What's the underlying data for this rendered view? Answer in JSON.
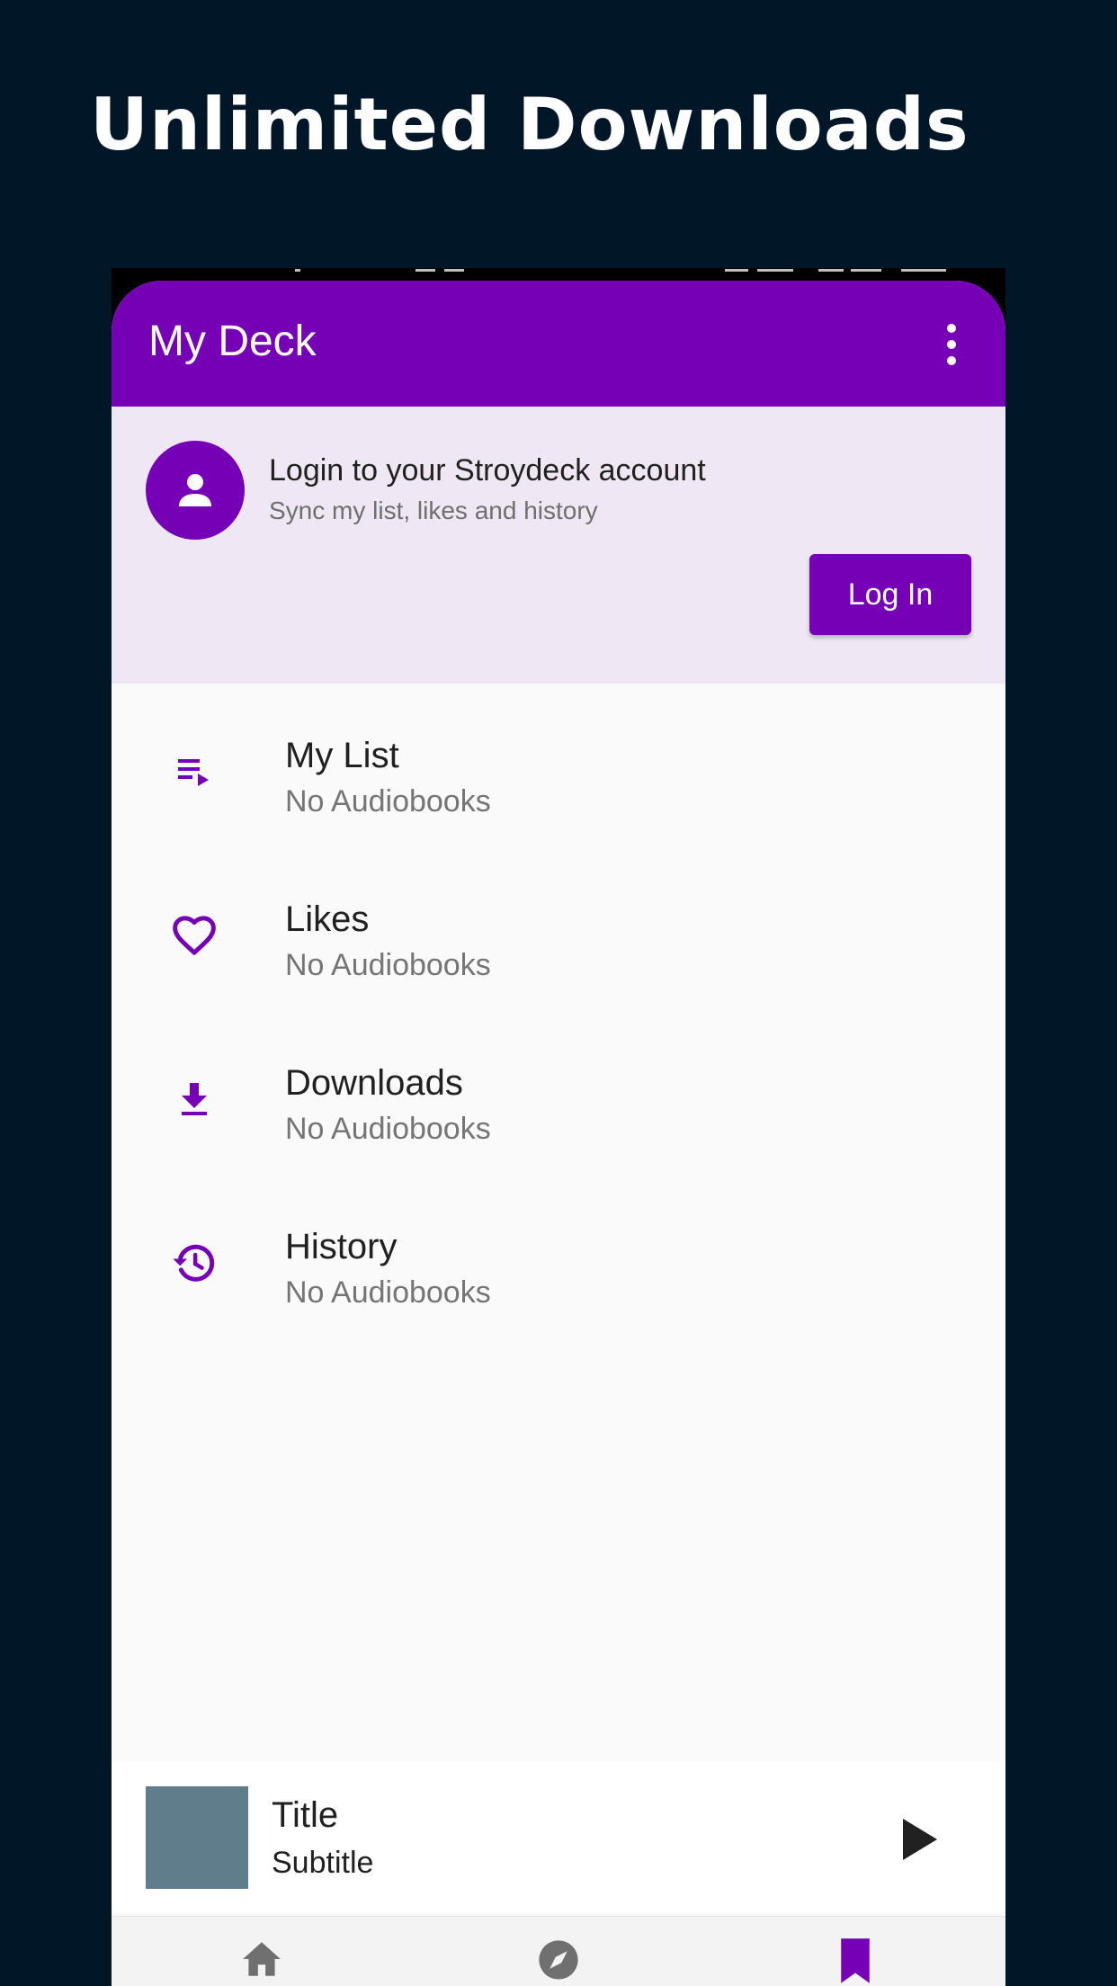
{
  "promo": {
    "headline": "Unlimited Downloads"
  },
  "appbar": {
    "title": "My Deck",
    "menu_icon": "more-vert-icon"
  },
  "login_card": {
    "avatar_icon": "person-icon",
    "title": "Login to your Stroydeck account",
    "subtitle": "Sync my list, likes and history",
    "button_label": "Log In"
  },
  "menu": {
    "items": [
      {
        "icon": "playlist-play-icon",
        "label": "My List",
        "sub": "No Audiobooks"
      },
      {
        "icon": "heart-outline-icon",
        "label": "Likes",
        "sub": "No Audiobooks"
      },
      {
        "icon": "download-icon",
        "label": "Downloads",
        "sub": "No Audiobooks"
      },
      {
        "icon": "history-icon",
        "label": "History",
        "sub": "No Audiobooks"
      }
    ]
  },
  "player": {
    "title": "Title",
    "subtitle": "Subtitle",
    "play_icon": "play-icon"
  },
  "bottom_nav": {
    "items": [
      {
        "icon": "home-icon",
        "active": false
      },
      {
        "icon": "explore-icon",
        "active": false
      },
      {
        "icon": "bookmark-icon",
        "active": true
      }
    ]
  },
  "colors": {
    "background": "#011627",
    "accent": "#7600b6",
    "card": "#efe7f3",
    "cover": "#607d8b"
  }
}
